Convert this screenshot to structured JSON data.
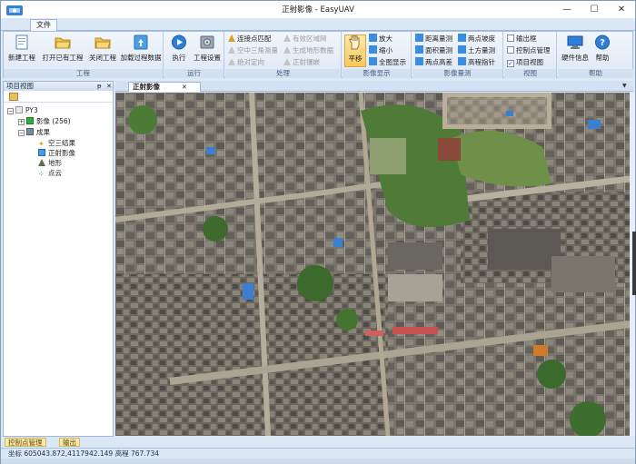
{
  "window": {
    "title": "正射影像 - EasyUAV",
    "minimize_glyph": "—",
    "maximize_glyph": "☐",
    "close_glyph": "✕"
  },
  "ribbon_tabs": [
    "文件"
  ],
  "ribbon": {
    "groups": {
      "project": {
        "label": "工程",
        "buttons": [
          "新建工程",
          "打开已有工程",
          "关闭工程",
          "加载过程数据"
        ]
      },
      "run": {
        "label": "运行",
        "buttons": [
          "执行",
          "工程设置"
        ]
      },
      "process": {
        "label": "处理",
        "items": [
          "连接点匹配",
          "空中三角测量",
          "绝对定向",
          "有效区域网",
          "生成地形数据",
          "正射镶嵌"
        ]
      },
      "display": {
        "label": "影像显示",
        "pan": "平移",
        "items": [
          "放大",
          "缩小",
          "全图显示"
        ]
      },
      "measure": {
        "label": "影像量测",
        "items": [
          "距离量测",
          "两点坡度",
          "面积量测",
          "土方量测",
          "两点高差",
          "高程指针"
        ]
      },
      "view": {
        "label": "视图",
        "items": [
          "输出框",
          "控制点管理",
          "项目视图"
        ],
        "checked": [
          false,
          false,
          true
        ]
      },
      "help": {
        "label": "帮助",
        "buttons": [
          "硬件信息",
          "帮助"
        ]
      }
    }
  },
  "project_panel": {
    "title": "项目视图",
    "pin_glyph": "ᵽ",
    "close_glyph": "✕",
    "tree": {
      "root": "PY3",
      "images": "影像 (256)",
      "results": "成果",
      "aerotriangulation": "空三结果",
      "orthophoto": "正射影像",
      "terrain": "地形",
      "pointcloud": "点云"
    }
  },
  "document": {
    "tab_label": "正射影像",
    "tab_close": "✕"
  },
  "bottom_tabs": [
    "控制点管理",
    "输出"
  ],
  "status": {
    "text": "坐标 605043.872,4117942.149 高程 767.734"
  },
  "colors": {
    "accent": "#1f5fb5",
    "ribbon_bg": "#dde8f6",
    "selected_tool": "#f9c95a"
  }
}
